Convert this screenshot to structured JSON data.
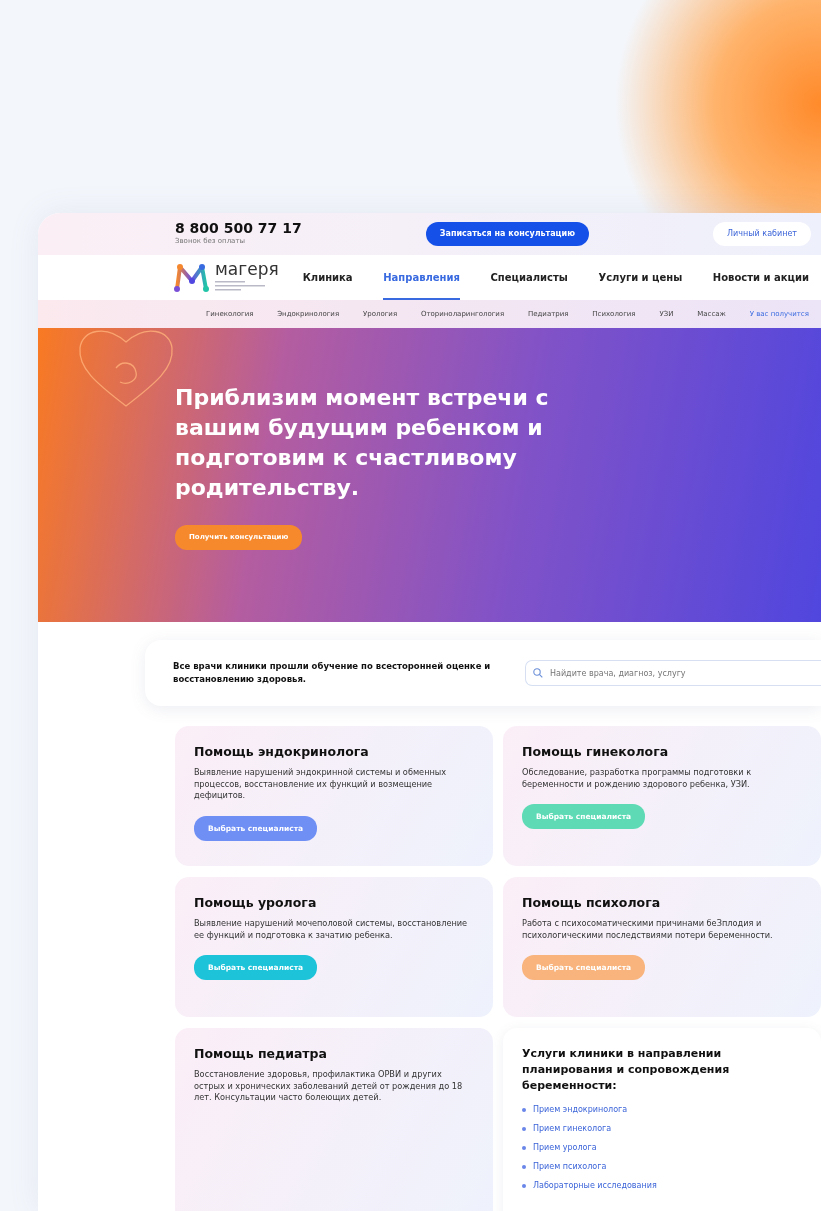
{
  "topbar": {
    "phone": "8 800 500 77 17",
    "phone_note": "Звонок без оплаты",
    "cta": "Записаться на консультацию",
    "account": "Личный кабинет"
  },
  "logo": {
    "name": "магеря"
  },
  "nav": [
    {
      "label": "Клиника",
      "selected": false
    },
    {
      "label": "Направления",
      "selected": true
    },
    {
      "label": "Специалисты",
      "selected": false
    },
    {
      "label": "Услуги и цены",
      "selected": false
    },
    {
      "label": "Новости и акции",
      "selected": false
    }
  ],
  "subnav": [
    {
      "label": "Гинекология",
      "selected": false
    },
    {
      "label": "Эндокринология",
      "selected": false
    },
    {
      "label": "Урология",
      "selected": false
    },
    {
      "label": "Оториноларингология",
      "selected": false
    },
    {
      "label": "Педиатрия",
      "selected": false
    },
    {
      "label": "Психология",
      "selected": false
    },
    {
      "label": "УЗИ",
      "selected": false
    },
    {
      "label": "Массаж",
      "selected": false
    },
    {
      "label": "У вас получится",
      "selected": true
    }
  ],
  "hero": {
    "title": "Приблизим момент встречи с вашим будущим ребенком и подготовим к счастливому родительству.",
    "button": "Получить консультацию"
  },
  "intro": {
    "text": "Все врачи клиники прошли обучение по всесторонней оценке и восстановлению здоровья.",
    "search_placeholder": "Найдите врача, диагноз, услугу"
  },
  "cards": [
    {
      "kind": "service",
      "title": "Помощь эндокринолога",
      "text": "Выявление нарушений эндокринной системы и обменных процессов, восстановление их функций и возмещение дефицитов.",
      "button": "Выбрать специалиста",
      "color": "#6f8ff5"
    },
    {
      "kind": "service",
      "title": "Помощь гинеколога",
      "text": "Обследование, разработка программы подготовки к беременности и рождению здорового ребенка, УЗИ.",
      "button": "Выбрать специалиста",
      "color": "#5edbb5"
    },
    {
      "kind": "service",
      "title": "Помощь уролога",
      "text": "Выявление нарушений мочеполовой системы, восстановление ее функций и подготовка к зачатию ребенка.",
      "button": "Выбрать специалиста",
      "color": "#1cc3d9"
    },
    {
      "kind": "service",
      "title": "Помощь психолога",
      "text": "Работа с психосоматическими причинами беЗплодия и психологическими последствиями потери беременности.",
      "button": "Выбрать специалиста",
      "color": "#f8b47c"
    },
    {
      "kind": "service",
      "title": "Помощь педиатра",
      "text": "Восстановление здоровья, профилактика ОРВИ и других острых и хронических заболеваний детей от рождения до 18 лет. Консультации часто болеющих детей."
    },
    {
      "kind": "list",
      "title": "Услуги клиники в направлении планирования и сопровождения беременности:",
      "items": [
        "Прием эндокринолога",
        "Прием гинеколога",
        "Прием уролога",
        "Прием психолога",
        "Лабораторные исследования"
      ]
    }
  ]
}
